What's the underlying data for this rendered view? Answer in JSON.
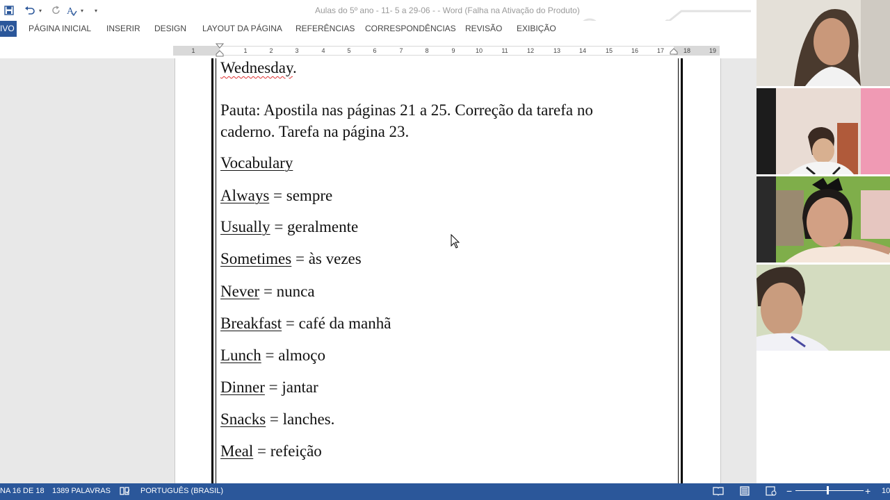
{
  "window": {
    "title": "Aulas do 5º ano - 11- 5 a 29-06 - - Word (Falha na Ativação do Produto)"
  },
  "quick_access": {
    "icons": [
      "save-icon",
      "undo-icon",
      "redo-icon",
      "spelling-icon",
      "customize-icon"
    ]
  },
  "ribbon": {
    "file_tab": "IVO",
    "tabs": [
      "PÁGINA INICIAL",
      "INSERIR",
      "DESIGN",
      "LAYOUT DA PÁGINA",
      "REFERÊNCIAS",
      "CORRESPONDÊNCIAS",
      "REVISÃO",
      "EXIBIÇÃO"
    ]
  },
  "ruler": {
    "numbers": [
      "1",
      "1",
      "2",
      "3",
      "4",
      "5",
      "6",
      "7",
      "8",
      "9",
      "10",
      "11",
      "12",
      "13",
      "14",
      "15",
      "16",
      "17",
      "18",
      "19"
    ]
  },
  "document": {
    "day": "Wednesday",
    "day_suffix": ".",
    "pauta_line1": "Pauta: Apostila nas páginas 21 a 25. Correção da tarefa no",
    "pauta_line2": "caderno.  Tarefa na página 23.",
    "vocab_heading": "Vocabulary",
    "vocab": [
      {
        "word": "Always",
        "sep": " = ",
        "meaning": "sempre"
      },
      {
        "word": "Usually",
        "sep": " = ",
        "meaning": "geralmente"
      },
      {
        "word": "Sometimes",
        "sep": " = ",
        "meaning": "às vezes"
      },
      {
        "word": "Never",
        "sep": " = ",
        "meaning": "nunca"
      },
      {
        "word": "Breakfast",
        "sep": " = ",
        "meaning": "café da manhã"
      },
      {
        "word": "Lunch",
        "sep": " = ",
        "meaning": "almoço"
      },
      {
        "word": "Dinner",
        "sep": " = ",
        "meaning": "jantar"
      },
      {
        "word": "Snacks",
        "sep": " = ",
        "meaning": "lanches."
      },
      {
        "word": "Meal",
        "sep": " = ",
        "meaning": "refeição"
      }
    ]
  },
  "statusbar": {
    "page": "NA 16 DE 18",
    "words": "1389 PALAVRAS",
    "language": "PORTUGUÊS (BRASIL)",
    "zoom": "10"
  },
  "video_tiles": [
    "participant-1",
    "participant-2",
    "participant-3",
    "participant-4"
  ],
  "colors": {
    "accent": "#2b579a",
    "spellcheck": "#e03030"
  }
}
